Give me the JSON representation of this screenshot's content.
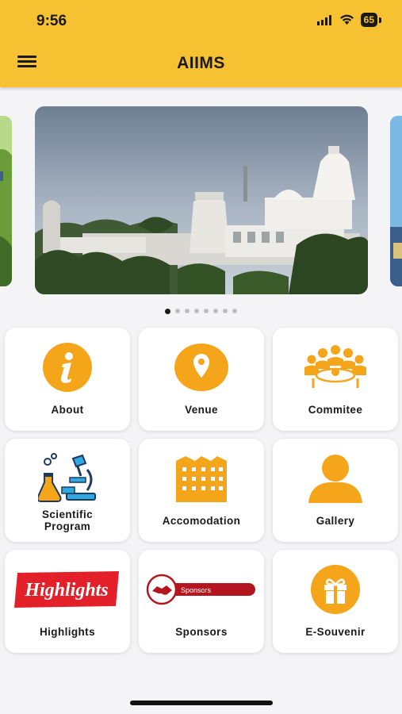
{
  "status_bar": {
    "time": "9:56",
    "battery": "65"
  },
  "app_bar": {
    "title": "AIIMS",
    "menu_icon": "hamburger-menu-icon"
  },
  "carousel": {
    "slide_count": 8,
    "active_index": 0
  },
  "tiles": [
    {
      "label": "About",
      "icon": "info-icon"
    },
    {
      "label": "Venue",
      "icon": "location-pin-icon"
    },
    {
      "label": "Commitee",
      "icon": "committee-meeting-icon"
    },
    {
      "label": "Scientific\nProgram",
      "icon": "microscope-lab-icon"
    },
    {
      "label": "Accomodation",
      "icon": "building-icon"
    },
    {
      "label": "Gallery",
      "icon": "person-icon"
    },
    {
      "label": "Highlights",
      "icon": "highlights-banner-icon",
      "banner_text": "Highlights"
    },
    {
      "label": "Sponsors",
      "icon": "sponsors-handshake-icon",
      "banner_text": "Sponsors"
    },
    {
      "label": "E-Souvenir",
      "icon": "gift-icon"
    }
  ],
  "colors": {
    "accent": "#f7c232",
    "icon_orange": "#f5a51a",
    "highlight_red": "#e3202a",
    "sponsor_red": "#b3161f"
  }
}
